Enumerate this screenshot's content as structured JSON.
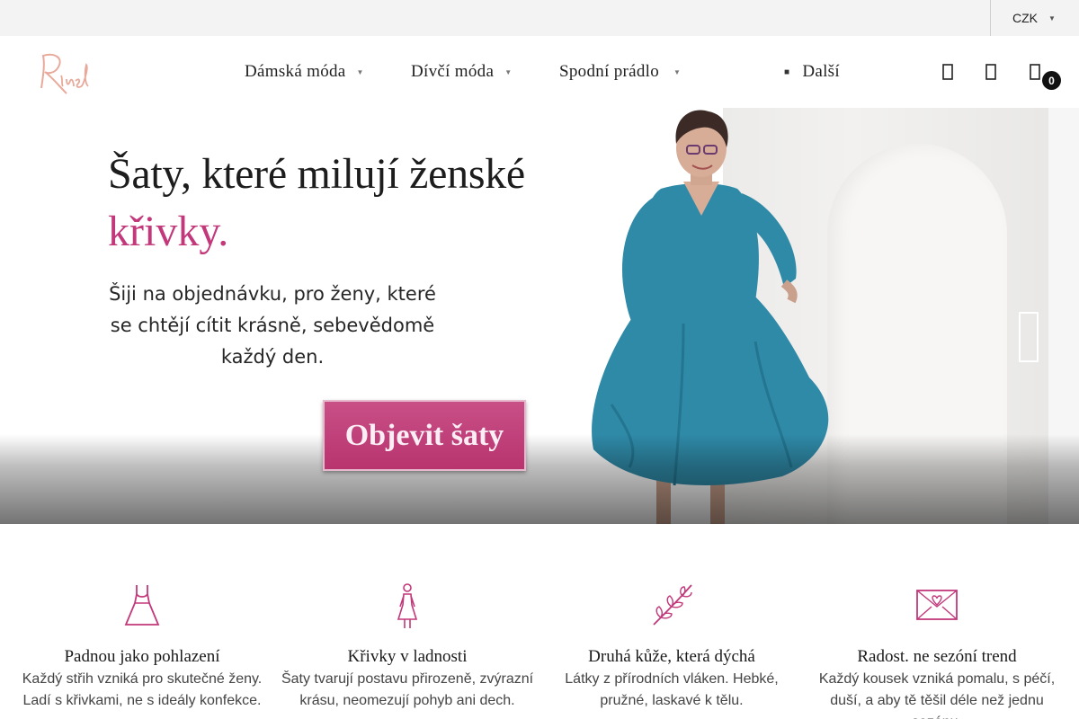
{
  "topbar": {
    "currency": "CZK"
  },
  "header": {
    "logo_text": "Rinel",
    "nav": [
      {
        "label": "Dámská móda"
      },
      {
        "label": "Dívčí móda"
      },
      {
        "label": "Spodní prádlo"
      },
      {
        "label": "Další"
      }
    ],
    "cart_count": "0"
  },
  "hero": {
    "title": "Šaty, které milují ženské",
    "accent": "křivky.",
    "subtitle": "Šiji na objednávku, pro ženy, které se chtějí cítit krásně, sebevědomě každý den.",
    "cta": "Objevit šaty",
    "colors": {
      "accent": "#c2387a",
      "button": "#b8346f",
      "dress": "#2f8aa8"
    }
  },
  "features": [
    {
      "icon": "dress-icon",
      "title": "Padnou jako pohlazení",
      "text": "Každý střih vzniká pro skutečné ženy. Ladí s křivkami, ne s ideály konfekce."
    },
    {
      "icon": "woman-figure-icon",
      "title": "Křivky v ladnosti",
      "text": "Šaty tvarují postavu přirozeně, zvýrazní krásu, neomezují pohyb ani dech."
    },
    {
      "icon": "leaf-icon",
      "title": "Druhá kůže, která dýchá",
      "text": "Látky z přírodních vláken. Hebké, pružné, laskavé k tělu."
    },
    {
      "icon": "envelope-heart-icon",
      "title": "Radost. ne sezóní trend",
      "text": "Každý kousek vzniká pomalu, s péčí, duší, a aby tě těšil déle než jednu sezónu."
    }
  ]
}
